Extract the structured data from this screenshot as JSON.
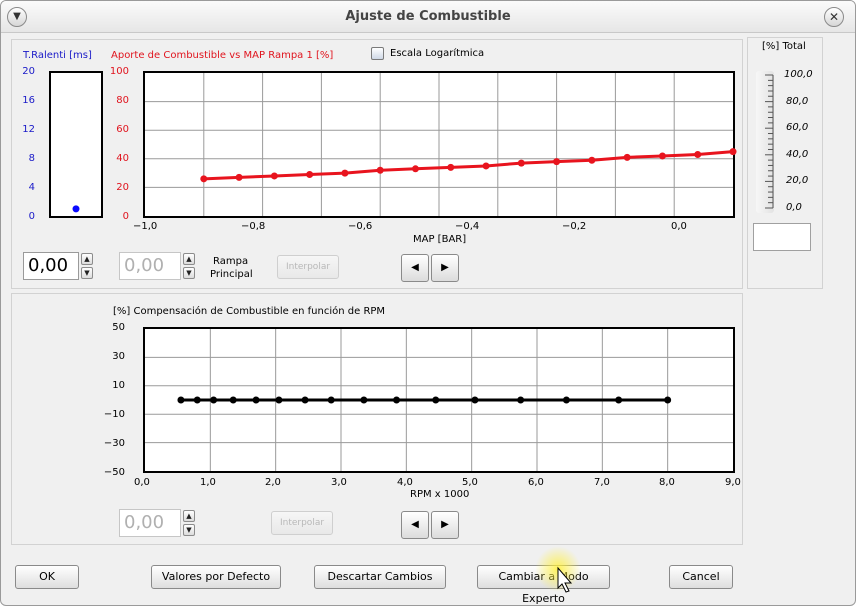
{
  "window": {
    "title": "Ajuste de Combustible"
  },
  "icons": {
    "menu": "chevron-down-icon",
    "close": "close-icon",
    "cursor": "mouse-pointer-icon"
  },
  "colors": {
    "red_series": "#e8141e",
    "black_series": "#000000",
    "idle_point": "#0a0aff",
    "blue_label": "#1a1ac8",
    "red_label": "#e0141e"
  },
  "idle": {
    "label": "T.Ralenti [ms]",
    "ticks": [
      "20",
      "16",
      "12",
      "8",
      "4",
      "0"
    ],
    "value": 1.0
  },
  "top_chart": {
    "title": "Aporte de Combustible vs MAP Rampa 1 [%]",
    "y_ticks": [
      "100",
      "80",
      "60",
      "40",
      "20",
      "0"
    ],
    "x_ticks": [
      "−1,0",
      "−0,8",
      "−0,6",
      "−0,4",
      "−0,2",
      "0,0"
    ],
    "xlabel": "MAP [BAR]",
    "log_scale_label": "Escala Logarítmica",
    "log_scale_checked": false
  },
  "total_gauge": {
    "label": "[%] Total",
    "ticks": [
      "100,0",
      "80,0",
      "60,0",
      "40,0",
      "20,0",
      "0,0"
    ]
  },
  "top_controls": {
    "idle_value": "0,00",
    "ramp_value": "0,00",
    "ramp_label_line1": "Rampa",
    "ramp_label_line2": "Principal",
    "interpolate_label": "Interpolar",
    "prev_glyph": "◀",
    "next_glyph": "▶"
  },
  "bottom_chart": {
    "title": "[%] Compensación de Combustible en función de RPM",
    "y_ticks": [
      "50",
      "30",
      "10",
      "−10",
      "−30",
      "−50"
    ],
    "x_ticks": [
      "0,0",
      "1,0",
      "2,0",
      "3,0",
      "4,0",
      "5,0",
      "6,0",
      "7,0",
      "8,0",
      "9,0"
    ],
    "xlabel": "RPM x 1000"
  },
  "bottom_controls": {
    "value": "0,00",
    "interpolate_label": "Interpolar",
    "prev_glyph": "◀",
    "next_glyph": "▶"
  },
  "footer": {
    "ok": "OK",
    "defaults": "Valores por Defecto",
    "discard": "Descartar Cambios",
    "expert": "Cambiar a Modo Experto",
    "cancel": "Cancel"
  },
  "chart_data": [
    {
      "type": "line",
      "title": "Aporte de Combustible vs MAP Rampa 1 [%]",
      "xlabel": "MAP [BAR]",
      "ylabel": "",
      "xlim": [
        -1.0,
        0.0
      ],
      "ylim": [
        0,
        100
      ],
      "grid": true,
      "series": [
        {
          "x": [
            -0.9,
            -0.84,
            -0.78,
            -0.72,
            -0.66,
            -0.6,
            -0.54,
            -0.48,
            -0.42,
            -0.36,
            -0.3,
            -0.24,
            -0.18,
            -0.12,
            -0.06,
            0.0
          ],
          "values": [
            26,
            27,
            28,
            29,
            30,
            32,
            33,
            34,
            35,
            37,
            38,
            39,
            41,
            42,
            43,
            45
          ]
        }
      ]
    },
    {
      "type": "line",
      "title": "[%] Compensación de Combustible en función de RPM",
      "xlabel": "RPM x 1000",
      "ylabel": "",
      "xlim": [
        0.0,
        9.0
      ],
      "ylim": [
        -50,
        50
      ],
      "grid": true,
      "series": [
        {
          "x": [
            0.55,
            0.8,
            1.05,
            1.35,
            1.7,
            2.05,
            2.45,
            2.85,
            3.35,
            3.85,
            4.45,
            5.05,
            5.75,
            6.45,
            7.25,
            8.0
          ],
          "values": [
            0,
            0,
            0,
            0,
            0,
            0,
            0,
            0,
            0,
            0,
            0,
            0,
            0,
            0,
            0,
            0
          ]
        }
      ]
    },
    {
      "type": "scatter",
      "title": "",
      "xlabel": "",
      "ylabel": "T.Ralenti [ms]",
      "ylim": [
        0,
        20
      ],
      "grid": false,
      "series": [
        {
          "values": [
            1.0
          ]
        }
      ]
    }
  ]
}
